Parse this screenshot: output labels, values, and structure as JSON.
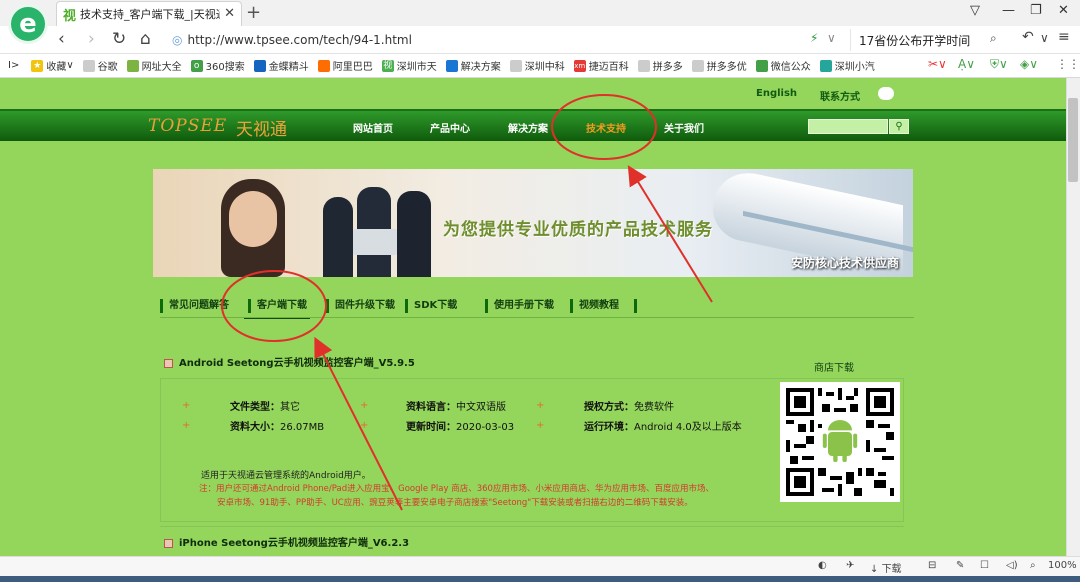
{
  "browser": {
    "tab_title": "技术支持_客户端下载_|天视通|无",
    "tab_favicon": "视",
    "url": "http://www.tpsee.com/tech/94-1.html",
    "news": "17省份公布开学时间",
    "bookmarks": [
      {
        "label": "收藏",
        "color": "#f1c40f"
      },
      {
        "label": "谷歌",
        "color": "#9e9e9e"
      },
      {
        "label": "网址大全",
        "color": "#7cb342"
      },
      {
        "label": "360搜索",
        "color": "#43a047"
      },
      {
        "label": "金蝶精斗",
        "color": "#1565c0"
      },
      {
        "label": "阿里巴巴",
        "color": "#ff6d00"
      },
      {
        "label": "深圳市天",
        "color": "#4caf50"
      },
      {
        "label": "解决方案",
        "color": "#1976d2"
      },
      {
        "label": "深圳中科",
        "color": "#9e9e9e"
      },
      {
        "label": "捷迈百科",
        "color": "#e53935"
      },
      {
        "label": "拼多多",
        "color": "#9e9e9e"
      },
      {
        "label": "拼多多优",
        "color": "#9e9e9e"
      },
      {
        "label": "微信公众",
        "color": "#43a047"
      },
      {
        "label": "深圳小汽",
        "color": "#26a69a"
      }
    ],
    "status": {
      "download": "下载",
      "zoom": "100%"
    }
  },
  "site": {
    "top_links": {
      "english": "English",
      "contact": "联系方式"
    },
    "brand_en": "TOPSEE",
    "brand_cn": "天视通",
    "nav": [
      {
        "label": "网站首页",
        "active": false
      },
      {
        "label": "产品中心",
        "active": false
      },
      {
        "label": "解决方案",
        "active": false
      },
      {
        "label": "技术支持",
        "active": true
      },
      {
        "label": "关于我们",
        "active": false
      }
    ],
    "banner": {
      "slogan": "为您提供专业优质的产品技术服务",
      "tagline": "安防核心技术供应商"
    },
    "subnav": [
      "常见问题解答",
      "客户端下载",
      "固件升级下载",
      "SDK下载",
      "使用手册下载",
      "视频教程"
    ],
    "item1": {
      "title": "Android Seetong云手机视频监控客户端_V5.9.5",
      "rows": [
        {
          "label": "文件类型：",
          "value": "其它"
        },
        {
          "label": "资料语言：",
          "value": "中文双语版"
        },
        {
          "label": "授权方式：",
          "value": "免费软件"
        },
        {
          "label": "资料大小：",
          "value": "26.07MB"
        },
        {
          "label": "更新时间：",
          "value": "2020-03-03"
        },
        {
          "label": "运行环境：",
          "value": "Android 4.0及以上版本"
        }
      ],
      "desc": "适用于天视通云管理系统的Android用户。",
      "note_line1": "注：用户还可通过Android Phone/Pad进入应用宝、Google Play 商店、360应用市场、小米应用商店、华为应用市场、百度应用市场、",
      "note_line2": "安卓市场、91助手、PP助手、UC应用、豌豆荚等主要安卓电子商店搜索\"Seetong\"下载安装或者扫描右边的二维码下载安装。",
      "qr_title": "商店下载"
    },
    "item2": {
      "title": "iPhone Seetong云手机视频监控客户端_V6.2.3"
    }
  }
}
